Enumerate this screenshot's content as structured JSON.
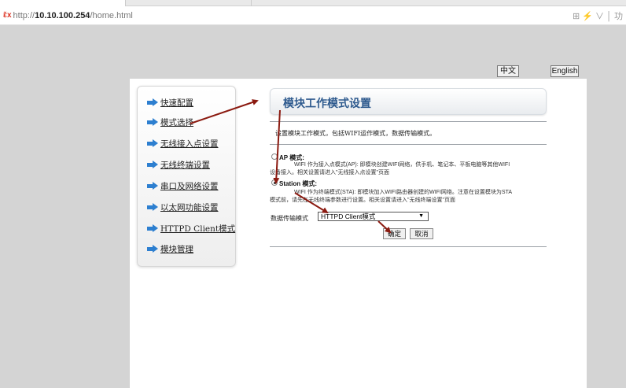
{
  "browser": {
    "url_scheme": "http://",
    "url_host": "10.10.100.254",
    "url_path": "/home.html",
    "right_text": "⊞ ⚡ ∨ │ 功"
  },
  "header": {
    "lang_zh": "中文",
    "lang_en": "English"
  },
  "sidebar": {
    "items": [
      {
        "label": "快速配置"
      },
      {
        "label": "模式选择"
      },
      {
        "label": "无线接入点设置"
      },
      {
        "label": "无线终端设置"
      },
      {
        "label": "串口及网络设置"
      },
      {
        "label": "以太网功能设置"
      },
      {
        "label": "HTTPD Client模式"
      },
      {
        "label": "模块管理"
      }
    ]
  },
  "main": {
    "title": "模块工作模式设置",
    "description": "设置模块工作模式，包括WIFI运作模式，数据传输模式。",
    "ap": {
      "label": "AP 模式:",
      "line1": "WIFI 作为接入点模式(AP): 即模块创建WIFI网络，供手机、笔记本、平板电脑等其他WIFI",
      "line2": "设备接入。相关设置请进入\"无线接入点设置\"页面",
      "checked": false
    },
    "station": {
      "label": "Station 模式:",
      "line1": "WIFI 作为终端模式(STA): 即模块加入WIFI路由器创建的WIFI网络。注意在设置模块为STA",
      "line2": "模式前，请先在无线终端参数进行设置。相关设置请进入\"无线终端设置\"页面",
      "checked": true
    },
    "transfer": {
      "label": "数据传输模式",
      "selected": "HTTPD Client模式"
    },
    "buttons": {
      "ok": "确定",
      "cancel": "取消"
    }
  },
  "colors": {
    "accent_blue": "#2d7fd0",
    "title_blue": "#2e5a8e",
    "annotation_red": "#8b1a10"
  }
}
